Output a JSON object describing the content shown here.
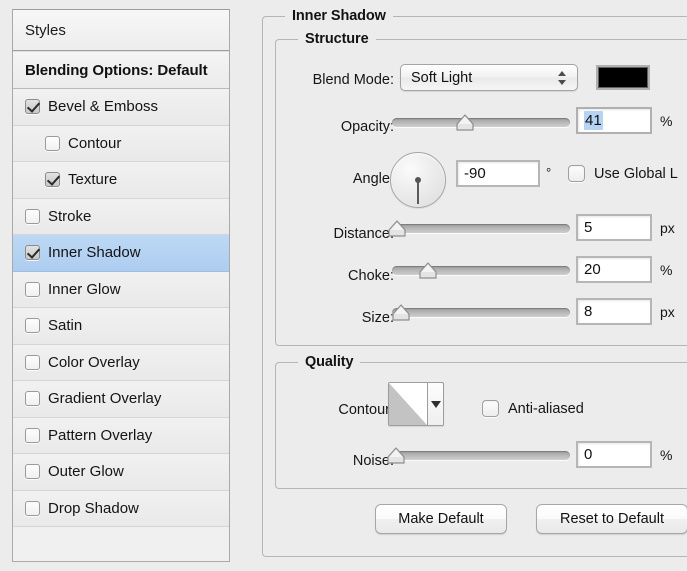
{
  "sidebar": {
    "header": "Styles",
    "blending_options": "Blending Options: Default",
    "items": [
      {
        "label": "Bevel & Emboss",
        "checked": true,
        "sub": false,
        "selected": false
      },
      {
        "label": "Contour",
        "checked": false,
        "sub": true,
        "selected": false
      },
      {
        "label": "Texture",
        "checked": true,
        "sub": true,
        "selected": false
      },
      {
        "label": "Stroke",
        "checked": false,
        "sub": false,
        "selected": false
      },
      {
        "label": "Inner Shadow",
        "checked": true,
        "sub": false,
        "selected": true
      },
      {
        "label": "Inner Glow",
        "checked": false,
        "sub": false,
        "selected": false
      },
      {
        "label": "Satin",
        "checked": false,
        "sub": false,
        "selected": false
      },
      {
        "label": "Color Overlay",
        "checked": false,
        "sub": false,
        "selected": false
      },
      {
        "label": "Gradient Overlay",
        "checked": false,
        "sub": false,
        "selected": false
      },
      {
        "label": "Pattern Overlay",
        "checked": false,
        "sub": false,
        "selected": false
      },
      {
        "label": "Outer Glow",
        "checked": false,
        "sub": false,
        "selected": false
      },
      {
        "label": "Drop Shadow",
        "checked": false,
        "sub": false,
        "selected": false
      }
    ]
  },
  "panel": {
    "title": "Inner Shadow",
    "structure": {
      "title": "Structure",
      "blend_mode_label": "Blend Mode:",
      "blend_mode_value": "Soft Light",
      "color_swatch": "#000000",
      "opacity_label": "Opacity:",
      "opacity_value": "41",
      "opacity_unit": "%",
      "opacity_pct": 41,
      "angle_label": "Angle:",
      "angle_value": "-90",
      "angle_unit": "°",
      "angle_deg": -90,
      "use_global_light_label": "Use Global L",
      "use_global_light_checked": false,
      "distance_label": "Distance:",
      "distance_value": "5",
      "distance_unit": "px",
      "distance_pct": 3,
      "choke_label": "Choke:",
      "choke_value": "20",
      "choke_unit": "%",
      "choke_pct": 20,
      "size_label": "Size:",
      "size_value": "8",
      "size_unit": "px",
      "size_pct": 5
    },
    "quality": {
      "title": "Quality",
      "contour_label": "Contour:",
      "anti_aliased_label": "Anti-aliased",
      "anti_aliased_checked": false,
      "noise_label": "Noise:",
      "noise_value": "0",
      "noise_unit": "%",
      "noise_pct": 2
    },
    "buttons": {
      "make_default": "Make Default",
      "reset_to_default": "Reset to Default"
    }
  },
  "colors": {
    "selection_blue": "#aecdf0",
    "text_selection_blue": "#b5d3f2",
    "window_bg": "#ececec"
  }
}
